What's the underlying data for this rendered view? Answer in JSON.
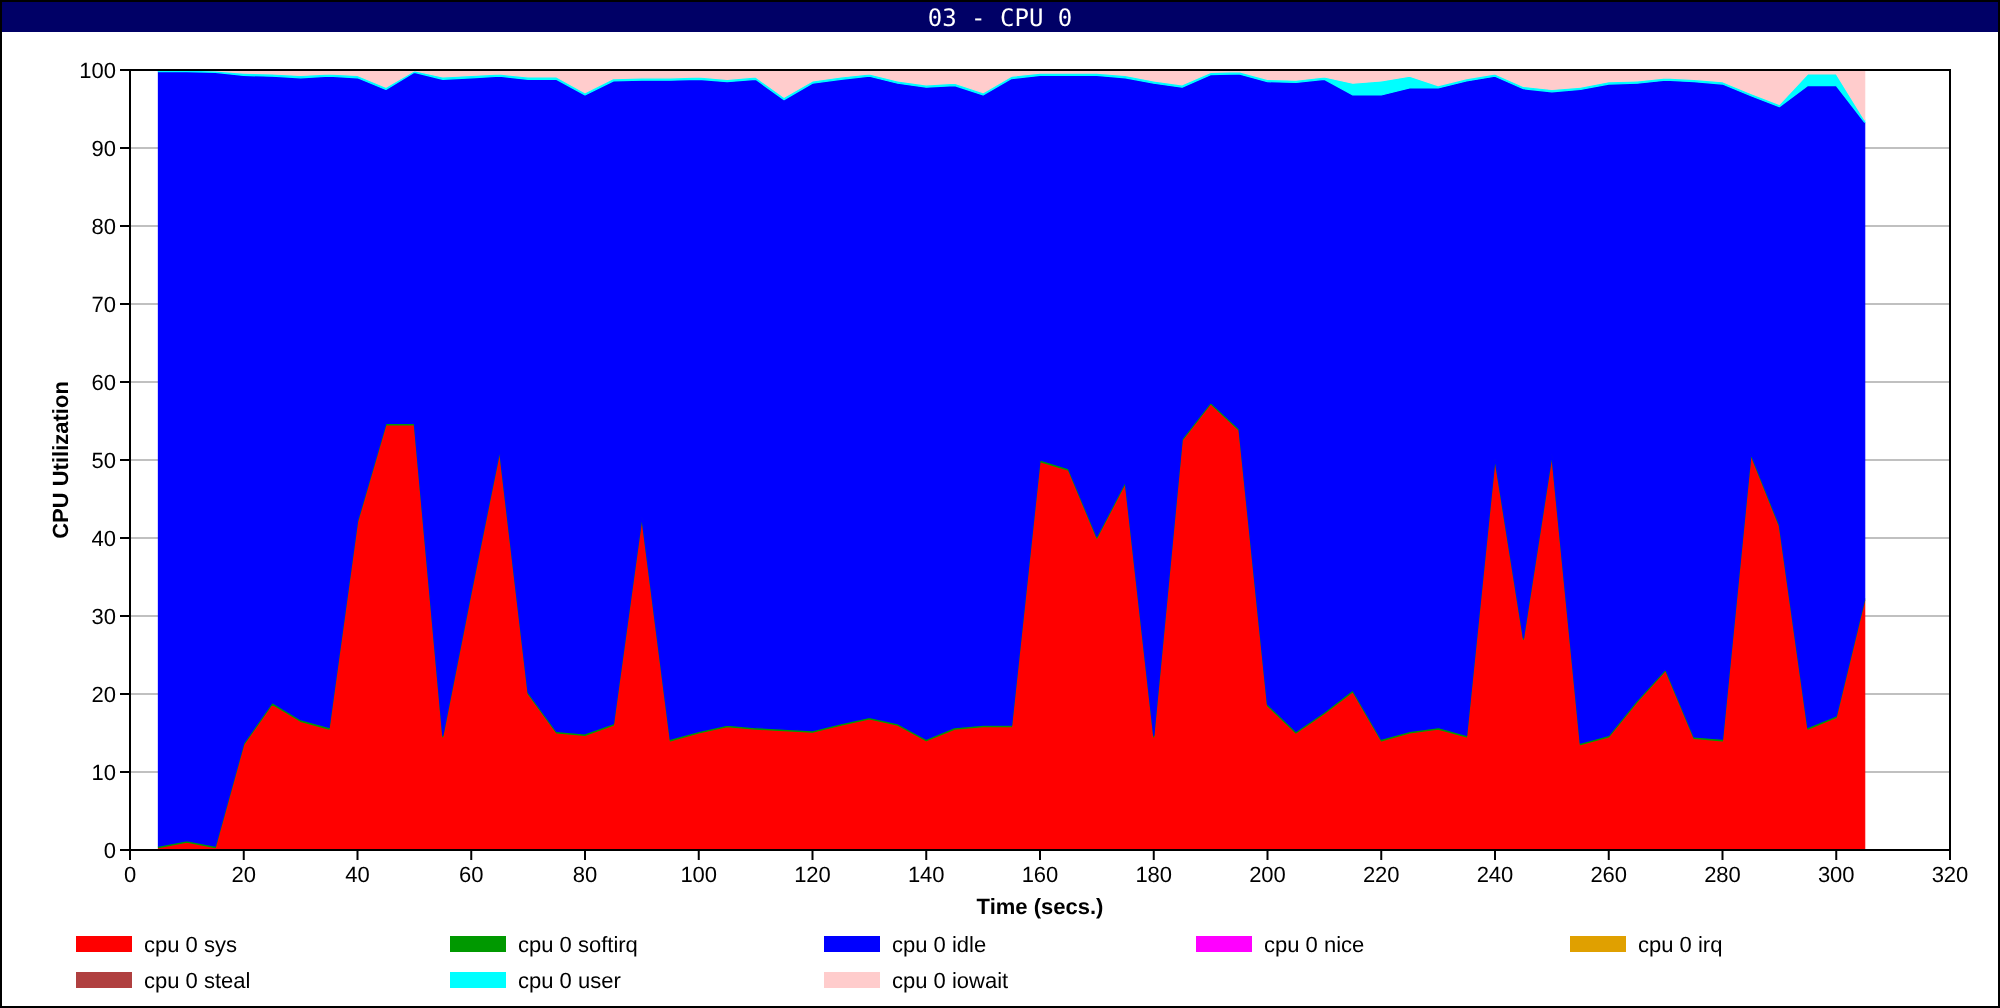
{
  "window": {
    "title": "03 - CPU 0"
  },
  "chart": {
    "chart_data": {
      "type": "area",
      "stacked": true,
      "grid": true,
      "legend": true,
      "xlabel": "Time (secs.)",
      "ylabel": "CPU Utilization",
      "x": [
        5,
        10,
        15,
        20,
        25,
        30,
        35,
        40,
        45,
        50,
        55,
        60,
        65,
        70,
        75,
        80,
        85,
        90,
        95,
        100,
        105,
        110,
        115,
        120,
        125,
        130,
        135,
        140,
        145,
        150,
        155,
        160,
        165,
        170,
        175,
        180,
        185,
        190,
        195,
        200,
        205,
        210,
        215,
        220,
        225,
        230,
        235,
        240,
        245,
        250,
        255,
        260,
        265,
        270,
        275,
        280,
        285,
        290,
        295,
        300,
        305
      ],
      "xlim": [
        0,
        320
      ],
      "ylim": [
        0,
        100
      ],
      "xticks": [
        0,
        20,
        40,
        60,
        80,
        100,
        120,
        140,
        160,
        180,
        200,
        220,
        240,
        260,
        280,
        300,
        320
      ],
      "yticks": [
        0,
        10,
        20,
        30,
        40,
        50,
        60,
        70,
        80,
        90,
        100
      ],
      "series": [
        {
          "name": "cpu 0 sys",
          "color": "#ff0000",
          "values": [
            0.3,
            1,
            0.3,
            13.5,
            18.7,
            16.5,
            15.5,
            42,
            54.5,
            54.5,
            14.5,
            33,
            51,
            20,
            15,
            14.7,
            16,
            42.5,
            14,
            15,
            15.8,
            15.5,
            15.3,
            15.1,
            16,
            16.8,
            16,
            14,
            15.5,
            15.8,
            15.8,
            49.8,
            48.7,
            40,
            47,
            14.5,
            52.5,
            57.2,
            53.8,
            18.5,
            15,
            17.5,
            20.3,
            14,
            15,
            15.5,
            14.5,
            50,
            27,
            50.5,
            13.5,
            14.5,
            19,
            23,
            14.3,
            14,
            50.6,
            41.5,
            15.5,
            17,
            32
          ]
        },
        {
          "name": "cpu 0 softirq",
          "color": "#009900",
          "values": [
            0.2,
            0.2,
            0.2,
            0.2,
            0.2,
            0.2,
            0.2,
            0.2,
            0.2,
            0.2,
            0.2,
            0.2,
            0.2,
            0.2,
            0.2,
            0.2,
            0.2,
            0.2,
            0.2,
            0.2,
            0.2,
            0.2,
            0.2,
            0.2,
            0.2,
            0.2,
            0.2,
            0.2,
            0.2,
            0.2,
            0.2,
            0.2,
            0.2,
            0.2,
            0.2,
            0.2,
            0.2,
            0.2,
            0.2,
            0.2,
            0.2,
            0.2,
            0.2,
            0.2,
            0.2,
            0.2,
            0.2,
            0.2,
            0.2,
            0.2,
            0.2,
            0.2,
            0.2,
            0.2,
            0.2,
            0.2,
            0.2,
            0.2,
            0.2,
            0.2,
            0.2
          ]
        },
        {
          "name": "cpu 0 idle",
          "color": "#0000ff",
          "values": [
            99.3,
            98.6,
            99.2,
            85.6,
            80.3,
            82.3,
            83.5,
            56.8,
            42.8,
            45,
            84.1,
            65.8,
            48,
            78.6,
            83.6,
            81.9,
            82.4,
            56,
            84.5,
            83.6,
            82.5,
            83.1,
            80.7,
            83,
            82.6,
            82.2,
            82.1,
            83.6,
            82.3,
            80.8,
            82.9,
            49.3,
            50.4,
            59.1,
            51.8,
            83.6,
            45.1,
            42,
            45.5,
            79.8,
            83.2,
            81.1,
            76.3,
            82.6,
            82.5,
            82,
            83.9,
            49,
            70.4,
            46.5,
            83.8,
            83.5,
            79.1,
            75.5,
            84,
            84,
            45.9,
            53.6,
            82.3,
            80.8,
            61.1
          ]
        },
        {
          "name": "cpu 0 nice",
          "color": "#ff00ff",
          "values": [
            null,
            null,
            null,
            null,
            null,
            null,
            null,
            null,
            null,
            null,
            null,
            null,
            null,
            null,
            null,
            null,
            null,
            null,
            null,
            null,
            null,
            null,
            null,
            null,
            null,
            null,
            null,
            null,
            null,
            null,
            null,
            null,
            null,
            null,
            null,
            null,
            null,
            null,
            null,
            null,
            null,
            null,
            null,
            null,
            null,
            null,
            null,
            null,
            null,
            null,
            null,
            null,
            null,
            null,
            null,
            null,
            null,
            null,
            null,
            null,
            null
          ]
        },
        {
          "name": "cpu 0 irq",
          "color": "#e0a000",
          "values": [
            null,
            null,
            null,
            null,
            null,
            null,
            null,
            null,
            null,
            null,
            null,
            null,
            null,
            null,
            null,
            null,
            null,
            null,
            null,
            null,
            null,
            null,
            null,
            null,
            null,
            null,
            null,
            null,
            null,
            null,
            null,
            null,
            null,
            null,
            null,
            null,
            null,
            null,
            null,
            null,
            null,
            null,
            null,
            null,
            null,
            null,
            null,
            null,
            null,
            null,
            null,
            null,
            null,
            null,
            null,
            null,
            null,
            null,
            null,
            null,
            null
          ]
        },
        {
          "name": "cpu 0 steal",
          "color": "#b04040",
          "values": [
            null,
            null,
            null,
            null,
            null,
            null,
            null,
            null,
            null,
            null,
            null,
            null,
            null,
            null,
            null,
            null,
            null,
            null,
            null,
            null,
            null,
            null,
            null,
            null,
            null,
            null,
            null,
            null,
            null,
            null,
            null,
            null,
            null,
            null,
            null,
            null,
            null,
            null,
            null,
            null,
            null,
            null,
            null,
            null,
            null,
            null,
            null,
            null,
            null,
            null,
            null,
            null,
            null,
            null,
            null,
            null,
            null,
            null,
            null,
            null,
            null
          ]
        },
        {
          "name": "cpu 0 user",
          "color": "#00ffff",
          "values": [
            0.2,
            0.2,
            0.2,
            0.3,
            0.3,
            0.3,
            0.3,
            0.3,
            0.3,
            0.2,
            0.3,
            0.3,
            0.3,
            0.3,
            0.3,
            0.3,
            0.3,
            0.3,
            0.3,
            0.3,
            0.3,
            0.3,
            0.3,
            0.3,
            0.3,
            0.3,
            0.3,
            0.3,
            0.3,
            0.3,
            0.3,
            0.3,
            0.3,
            0.3,
            0.3,
            0.3,
            0.3,
            0.3,
            0.3,
            0.3,
            0.3,
            0.3,
            1.5,
            1.8,
            1.5,
            0.3,
            0.3,
            0.3,
            0.3,
            0.3,
            0.3,
            0.3,
            0.3,
            0.3,
            0.3,
            0.3,
            0.3,
            0.3,
            1.5,
            1.5,
            0.3
          ]
        },
        {
          "name": "cpu 0 iowait",
          "color": "#ffcccc",
          "values": [
            0,
            0,
            0.1,
            0.4,
            0.5,
            0.7,
            0.5,
            0.7,
            2.2,
            0.1,
            0.9,
            0.7,
            0.5,
            0.9,
            0.9,
            2.9,
            1.1,
            1,
            1,
            0.9,
            1.2,
            0.9,
            3.5,
            1.4,
            0.9,
            0.5,
            1.4,
            1.9,
            1.7,
            2.9,
            0.8,
            0.4,
            0.4,
            0.4,
            0.7,
            1.4,
            1.9,
            0.3,
            0.2,
            1.2,
            1.3,
            0.9,
            1.7,
            1.4,
            0.8,
            2,
            1.1,
            0.5,
            2.1,
            2.5,
            2.2,
            1.5,
            1.4,
            1,
            1.2,
            1.5,
            3,
            4.4,
            0.5,
            0.5,
            6.4
          ]
        }
      ]
    }
  }
}
